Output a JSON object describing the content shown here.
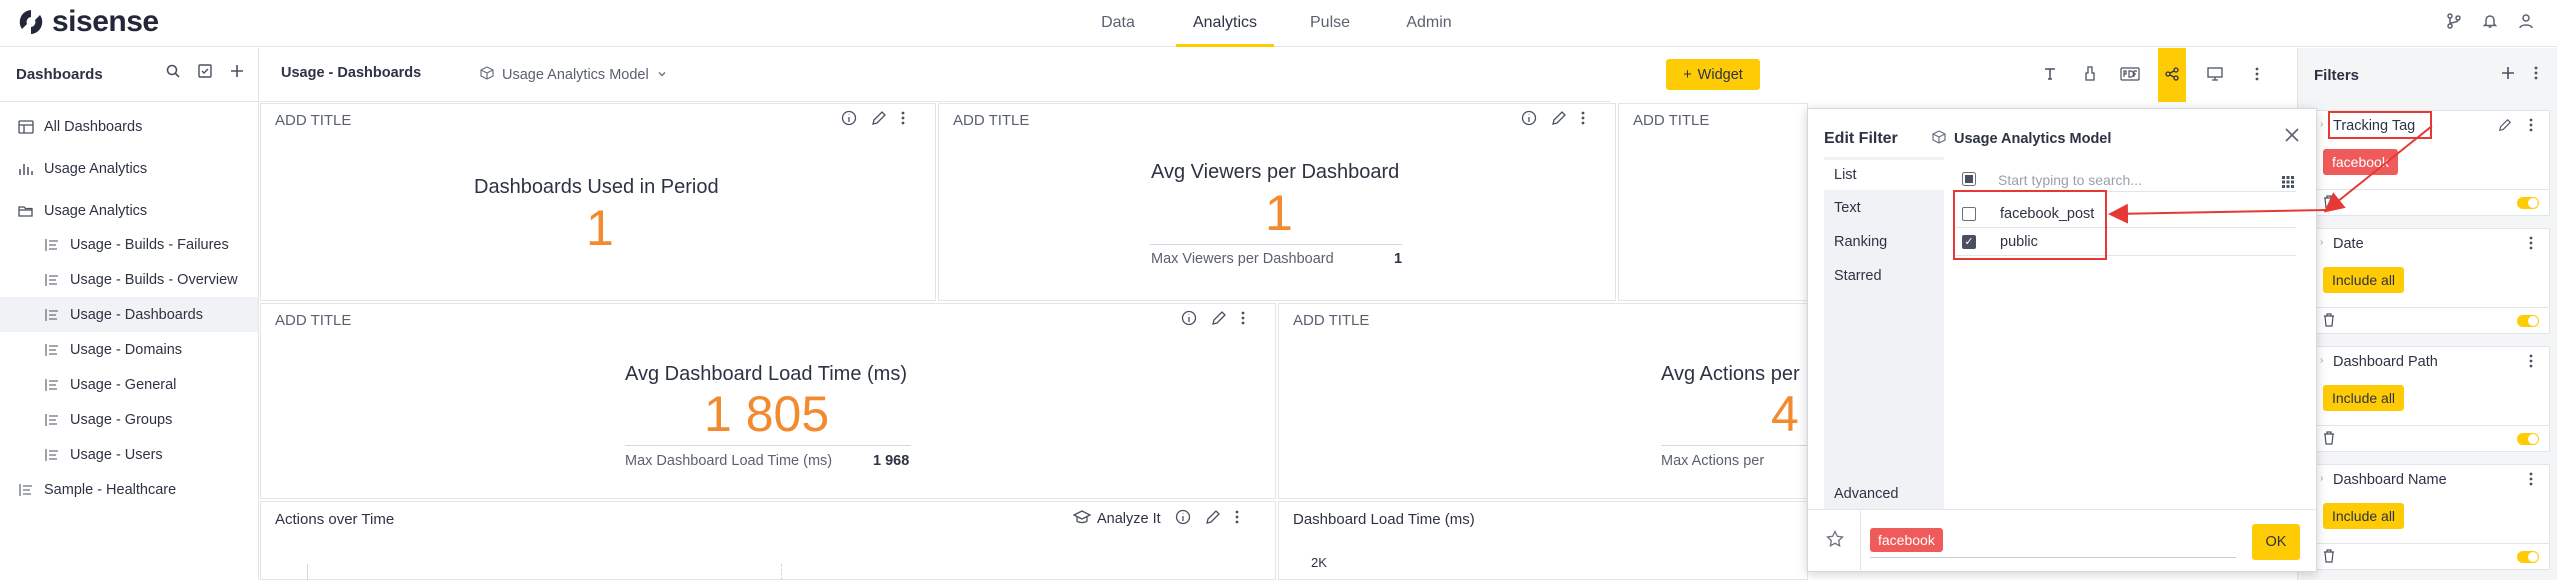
{
  "app": {
    "brand": "sisense"
  },
  "topnav": {
    "items": [
      "Data",
      "Analytics",
      "Pulse",
      "Admin"
    ],
    "active": "Analytics"
  },
  "sidebar": {
    "title": "Dashboards",
    "items": [
      {
        "label": "All Dashboards"
      },
      {
        "label": "Usage Analytics"
      },
      {
        "label": "Usage Analytics"
      },
      {
        "label": "Usage - Builds - Failures"
      },
      {
        "label": "Usage - Builds - Overview"
      },
      {
        "label": "Usage - Dashboards"
      },
      {
        "label": "Usage - Domains"
      },
      {
        "label": "Usage - General"
      },
      {
        "label": "Usage - Groups"
      },
      {
        "label": "Usage - Users"
      },
      {
        "label": "Sample - Healthcare"
      }
    ]
  },
  "dashboard": {
    "title": "Usage - Dashboards",
    "model": "Usage Analytics Model",
    "widget_button": "Widget"
  },
  "widgets": {
    "w1": {
      "title": "ADD TITLE",
      "label": "Dashboards Used in Period",
      "value": "1"
    },
    "w2": {
      "title": "ADD TITLE",
      "label": "Avg Viewers per Dashboard",
      "value": "1",
      "sub_label": "Max Viewers per Dashboard",
      "sub_value": "1"
    },
    "w3": {
      "title": "ADD TITLE"
    },
    "w4": {
      "title": "ADD TITLE",
      "label": "Avg Dashboard Load Time (ms)",
      "value": "1 805",
      "sub_label": "Max Dashboard Load Time (ms)",
      "sub_value": "1 968"
    },
    "w5": {
      "title": "ADD TITLE",
      "label": "Avg Actions per",
      "value": "4",
      "sub_label": "Max Actions per"
    },
    "w6": {
      "title": "Actions over Time",
      "analyze": "Analyze It"
    },
    "w7": {
      "title": "Dashboard Load Time (ms)",
      "axis_tick": "2K"
    }
  },
  "edit_filter": {
    "title": "Edit Filter",
    "model": "Usage Analytics Model",
    "tabs": [
      "List",
      "Text",
      "Ranking",
      "Starred"
    ],
    "advanced": "Advanced",
    "search_placeholder": "Start typing to search...",
    "options": [
      {
        "label": "facebook_post",
        "checked": false
      },
      {
        "label": "public",
        "checked": true
      }
    ],
    "selected_chip": "facebook",
    "ok": "OK"
  },
  "filters": {
    "title": "Filters",
    "cards": [
      {
        "title": "Tracking Tag",
        "chip": "facebook",
        "chip_color": "#ef5b5b"
      },
      {
        "title": "Date",
        "chip": "Include all",
        "chip_color": "#ffcb05"
      },
      {
        "title": "Dashboard Path",
        "chip": "Include all",
        "chip_color": "#ffcb05"
      },
      {
        "title": "Dashboard Name",
        "chip": "Include all",
        "chip_color": "#ffcb05"
      }
    ]
  },
  "colors": {
    "accent": "#ffcb05",
    "kpi": "#f28b30",
    "chip_red": "#ef5b5b",
    "annotation": "#e53935"
  }
}
